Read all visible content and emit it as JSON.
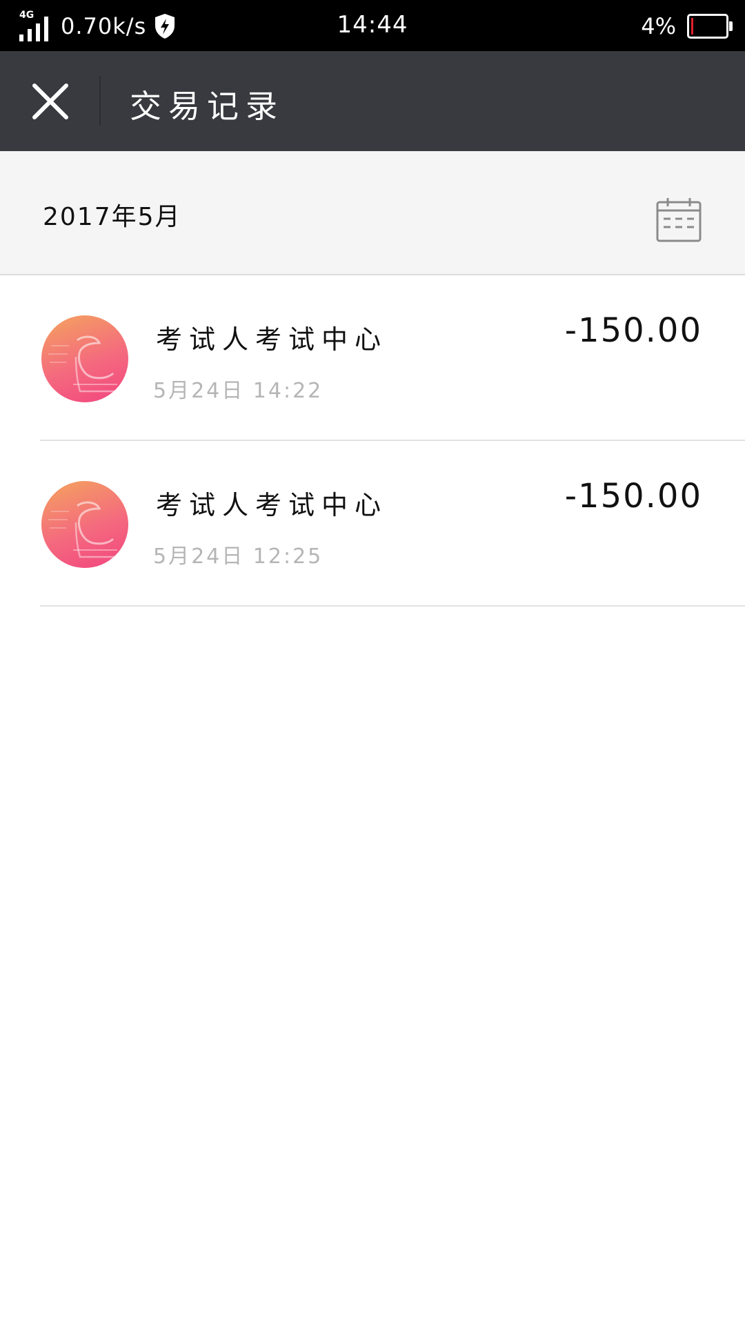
{
  "status_bar": {
    "network": "4G",
    "speed": "0.70k/s",
    "time": "14:44",
    "battery_percent": "4%",
    "battery_level": 0.04,
    "icons": [
      "signal-icon",
      "shield-bolt-icon",
      "battery-icon"
    ],
    "battery_low_color": "#e0202a"
  },
  "header": {
    "title": "交易记录",
    "close_icon": "close-icon",
    "background": "#393a3f"
  },
  "month_bar": {
    "label": "2017年5月",
    "calendar_icon": "calendar-icon"
  },
  "transactions": [
    {
      "name": "考试人考试中心",
      "time": "5月24日  14:22",
      "amount": "-150.00",
      "avatar_icon": "merchant-logo"
    },
    {
      "name": "考试人考试中心",
      "time": "5月24日  12:25",
      "amount": "-150.00",
      "avatar_icon": "merchant-logo"
    }
  ]
}
